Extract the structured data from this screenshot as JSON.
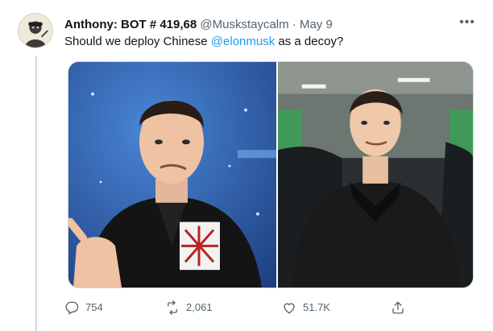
{
  "tweet": {
    "display_name": "Anthony: BOT # 419,68",
    "handle": "@Muskstaycalm",
    "separator": "·",
    "date": "May 9",
    "more_label": "•••",
    "text_before": "Should we deploy Chinese ",
    "mention": "@elonmusk",
    "text_after": " as a decoy?"
  },
  "actions": {
    "reply_count": "754",
    "retweet_count": "2,061",
    "like_count": "51.7K"
  },
  "icons": {
    "reply": "reply-icon",
    "retweet": "retweet-icon",
    "like": "heart-icon",
    "share": "share-icon",
    "more": "more-icon"
  },
  "colors": {
    "text": "#0f1419",
    "secondary": "#536471",
    "link": "#1d9bf0",
    "border": "#cfd9de"
  }
}
